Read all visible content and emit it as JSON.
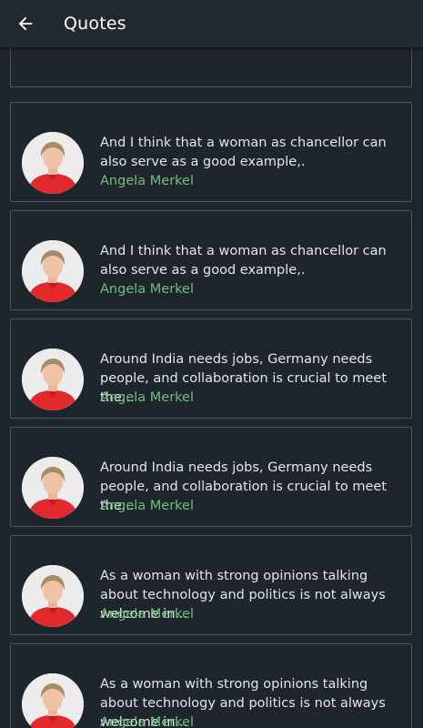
{
  "appbar": {
    "title": "Quotes",
    "back_icon": "arrow-left-icon"
  },
  "colors": {
    "background": "#1f252c",
    "card_border": "#4c5359",
    "author_text": "#6fbf7e",
    "quote_text": "#e6e6e6"
  },
  "quotes": [
    {
      "text": "And I think that a woman as chancellor can also serve as a good example,.",
      "author": "Angela Merkel"
    },
    {
      "text": "And I think that a woman as chancellor can also serve as a good example,.",
      "author": "Angela Merkel"
    },
    {
      "text": "Around India needs jobs, Germany needs people, and collaboration is crucial to meet the...",
      "author": "Angela Merkel"
    },
    {
      "text": "Around India needs jobs, Germany needs people, and collaboration is crucial to meet the...",
      "author": "Angela Merkel"
    },
    {
      "text": "As a woman with strong opinions talking about technology and politics is not always welcome in...",
      "author": "Angela Merkel"
    },
    {
      "text": "As a woman with strong opinions talking about technology and politics is not always welcome in...",
      "author": "Angela Merkel"
    }
  ]
}
